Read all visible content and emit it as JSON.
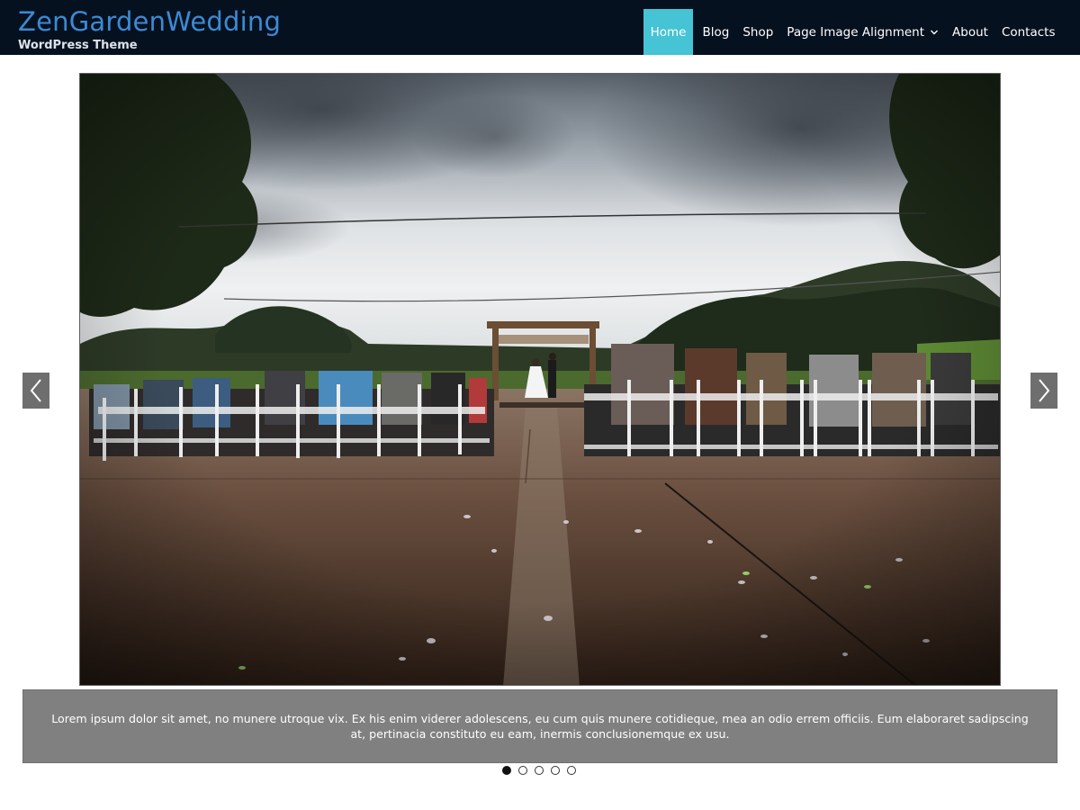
{
  "header": {
    "site_title": "ZenGardenWedding",
    "tagline": "WordPress Theme",
    "background_color": "#06111f",
    "title_color": "#3c8ad4"
  },
  "nav": {
    "active_color": "#46c3d5",
    "items": [
      {
        "label": "Home",
        "active": true
      },
      {
        "label": "Blog"
      },
      {
        "label": "Shop"
      },
      {
        "label": "Page Image Alignment",
        "has_dropdown": true,
        "icon": "chevron-down-icon"
      },
      {
        "label": "About"
      },
      {
        "label": "Contacts"
      }
    ]
  },
  "slider": {
    "image_subject": "outdoor wedding ceremony, guests seated in white folding chairs, bride and groom at wooden arbor under string lights",
    "prev_icon": "chevron-left-icon",
    "next_icon": "chevron-right-icon",
    "caption": "Lorem ipsum dolor sit amet, no munere utroque vix. Ex his enim viderer adolescens, eu cum quis munere cotidieque, mea an odio errem officiis. Eum elaboraret sadipscing at, pertinacia constituto eu eam, inermis conclusionemque ex usu.",
    "slide_count": 5,
    "current_slide": 1
  }
}
